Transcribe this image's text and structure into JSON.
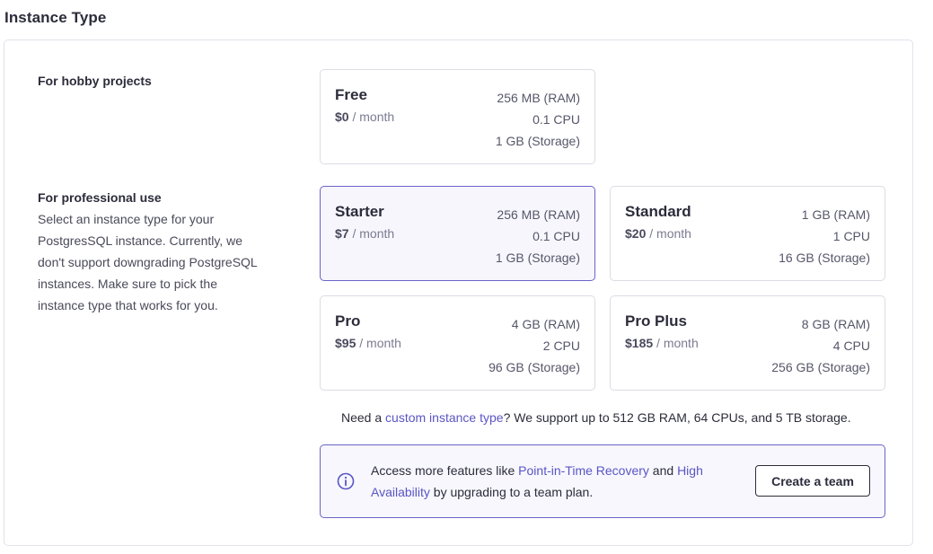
{
  "page": {
    "title": "Instance Type"
  },
  "sections": {
    "hobby": {
      "title": "For hobby projects"
    },
    "professional": {
      "title": "For professional use",
      "description": "Select an instance type for your PostgresSQL instance. Currently, we don't support downgrading PostgreSQL instances. Make sure to pick the instance type that works for you."
    }
  },
  "plans": [
    {
      "name": "Free",
      "price": "$0",
      "period": "/ month",
      "ram": "256 MB (RAM)",
      "cpu": "0.1 CPU",
      "storage": "1 GB (Storage)",
      "selected": false
    },
    {
      "name": "Starter",
      "price": "$7",
      "period": "/ month",
      "ram": "256 MB (RAM)",
      "cpu": "0.1 CPU",
      "storage": "1 GB (Storage)",
      "selected": true
    },
    {
      "name": "Standard",
      "price": "$20",
      "period": "/ month",
      "ram": "1 GB (RAM)",
      "cpu": "1 CPU",
      "storage": "16 GB (Storage)",
      "selected": false
    },
    {
      "name": "Pro",
      "price": "$95",
      "period": "/ month",
      "ram": "4 GB (RAM)",
      "cpu": "2 CPU",
      "storage": "96 GB (Storage)",
      "selected": false
    },
    {
      "name": "Pro Plus",
      "price": "$185",
      "period": "/ month",
      "ram": "8 GB (RAM)",
      "cpu": "4 CPU",
      "storage": "256 GB (Storage)",
      "selected": false
    }
  ],
  "note": {
    "prefix": "Need a ",
    "link": "custom instance type",
    "suffix": "? We support up to 512 GB RAM, 64 CPUs, and 5 TB storage."
  },
  "banner": {
    "icon": "info-icon",
    "text1": "Access more features like ",
    "link1": "Point-in-Time Recovery",
    "text2": " and ",
    "link2": "High Availability",
    "text3": " by upgrading to a team plan.",
    "button": "Create a team"
  },
  "colors": {
    "accent": "#5a55c4",
    "selected_border": "#6a64c8",
    "selected_bg": "#f6f6fc",
    "text": "#2c2c3b"
  }
}
